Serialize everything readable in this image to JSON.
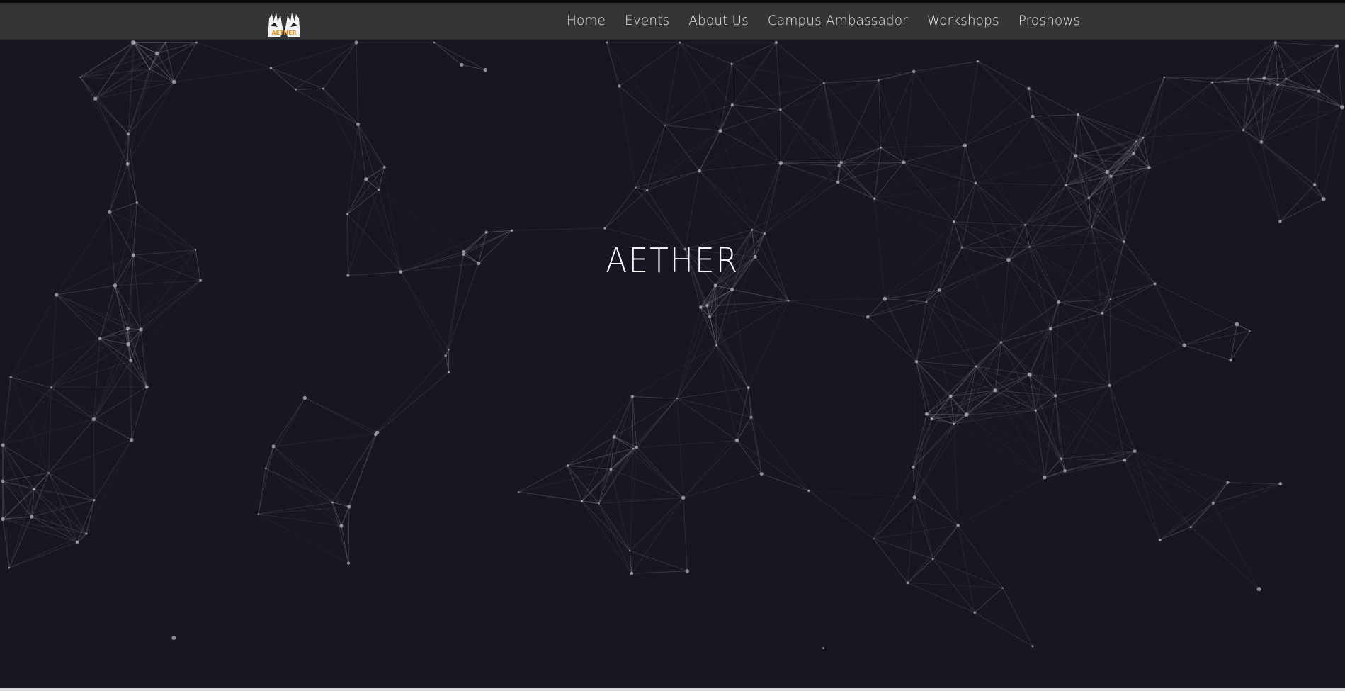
{
  "brand": {
    "logo_text": "AETHER",
    "logo_accent_color": "#e8921e"
  },
  "nav": {
    "items": [
      {
        "label": "Home"
      },
      {
        "label": "Events"
      },
      {
        "label": "About Us"
      },
      {
        "label": "Campus Ambassador"
      },
      {
        "label": "Workshops"
      },
      {
        "label": "Proshows"
      }
    ]
  },
  "hero": {
    "title": "AETHER"
  },
  "theme": {
    "background": "#161722",
    "navbar_background": "#3c3c3c",
    "network_line_color": "#8a8a96",
    "network_node_color": "#b4b4bc"
  }
}
